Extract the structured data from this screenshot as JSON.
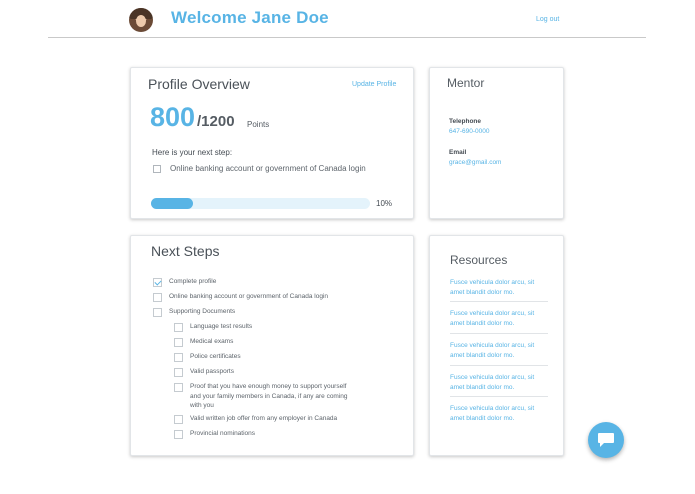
{
  "header": {
    "welcome": "Welcome Jane Doe",
    "logout_label": "Log out"
  },
  "profile": {
    "title": "Profile Overview",
    "update_label": "Update Profile",
    "points": "800",
    "points_total": "/1200",
    "points_unit": "Points",
    "next_step_label": "Here is your next step:",
    "next_step_item": "Online banking account or government of Canada login",
    "progress_percent": 10,
    "progress_label": "10%"
  },
  "mentor": {
    "title": "Mentor",
    "telephone_label": "Telephone",
    "telephone": "647-690-0000",
    "email_label": "Email",
    "email": "grace@gmail.com"
  },
  "steps": {
    "title": "Next Steps",
    "items": [
      {
        "label": "Complete profile",
        "checked": true
      },
      {
        "label": "Online banking account or government of Canada login",
        "checked": false
      },
      {
        "label": "Supporting Documents",
        "checked": false
      },
      {
        "label": "Language test results",
        "checked": false
      },
      {
        "label": "Medical exams",
        "checked": false
      },
      {
        "label": "Police certificates",
        "checked": false
      },
      {
        "label": "Valid passports",
        "checked": false
      },
      {
        "label": "Proof that you have enough money to support yourself and your family members in Canada, if any are coming with you",
        "checked": false
      },
      {
        "label": "Valid written job offer from any employer in Canada",
        "checked": false
      },
      {
        "label": "Provincial nominations",
        "checked": false
      }
    ]
  },
  "resources": {
    "title": "Resources",
    "links": [
      "Fusce vehicula dolor arcu, sit amet blandit dolor mo.",
      "Fusce vehicula dolor arcu, sit amet blandit dolor mo.",
      "Fusce vehicula dolor arcu, sit amet blandit dolor mo.",
      "Fusce vehicula dolor arcu, sit amet blandit dolor mo.",
      "Fusce vehicula dolor arcu, sit amet blandit dolor mo."
    ]
  },
  "icons": {
    "avatar": "user-avatar",
    "chat": "chat-bubble-icon"
  },
  "colors": {
    "accent": "#58b4e5",
    "progress_track": "#e4f3fb"
  }
}
